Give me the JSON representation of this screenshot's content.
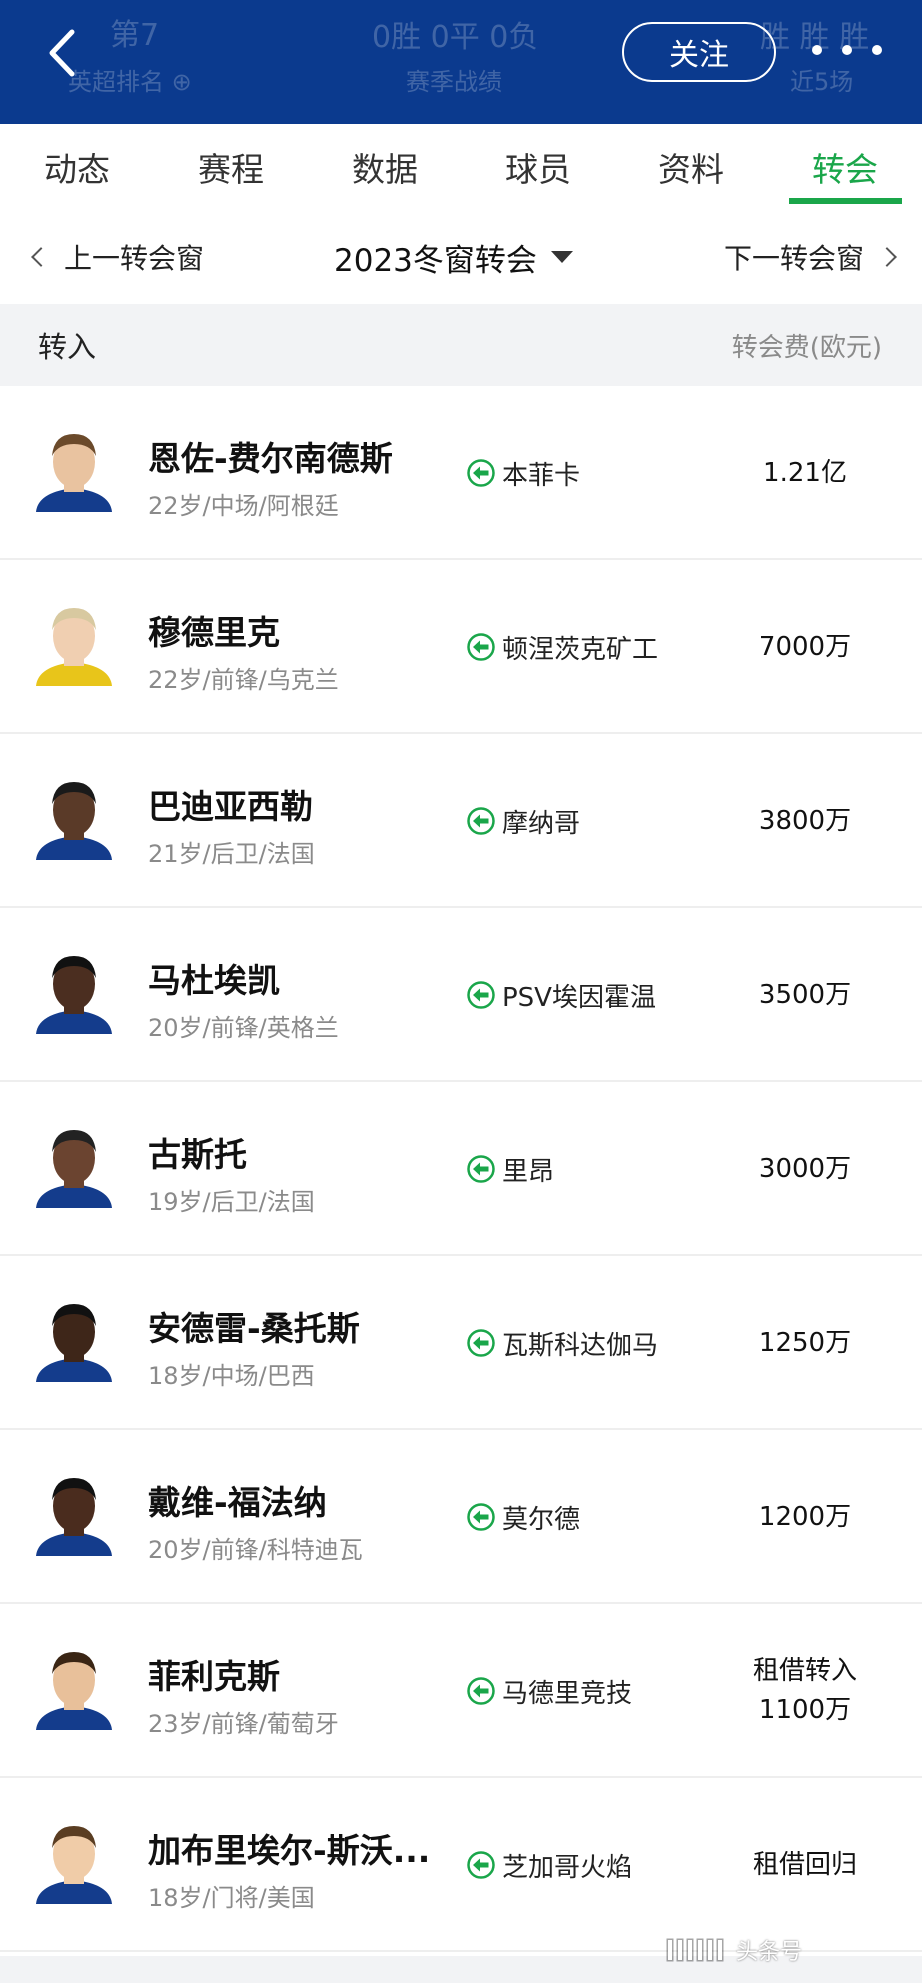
{
  "header": {
    "ghost_left_top": "第7",
    "ghost_left_bottom": "英超排名 ⊕",
    "ghost_mid_top": "0胜 0平 0负",
    "ghost_mid_bottom": "赛季战绩",
    "ghost_right_top": "胜 胜 胜",
    "ghost_right_bottom": "近5场",
    "follow_label": "关注",
    "colors": {
      "background": "#0b3a8e",
      "accent": "#1aa64a"
    }
  },
  "tabs": [
    "动态",
    "赛程",
    "数据",
    "球员",
    "资料",
    "转会"
  ],
  "active_tab": "转会",
  "window_nav": {
    "prev_label": "上一转会窗",
    "current_label": "2023冬窗转会",
    "next_label": "下一转会窗"
  },
  "section": {
    "title": "转入",
    "fee_header": "转会费(欧元)"
  },
  "players": [
    {
      "name": "恩佐-费尔南德斯",
      "info": "22岁/中场/阿根廷",
      "from_club": "本菲卡",
      "fee_line1": "1.21亿",
      "fee_line2": ""
    },
    {
      "name": "穆德里克",
      "info": "22岁/前锋/乌克兰",
      "from_club": "顿涅茨克矿工",
      "fee_line1": "7000万",
      "fee_line2": ""
    },
    {
      "name": "巴迪亚西勒",
      "info": "21岁/后卫/法国",
      "from_club": "摩纳哥",
      "fee_line1": "3800万",
      "fee_line2": ""
    },
    {
      "name": "马杜埃凯",
      "info": "20岁/前锋/英格兰",
      "from_club": "PSV埃因霍温",
      "fee_line1": "3500万",
      "fee_line2": ""
    },
    {
      "name": "古斯托",
      "info": "19岁/后卫/法国",
      "from_club": "里昂",
      "fee_line1": "3000万",
      "fee_line2": ""
    },
    {
      "name": "安德雷-桑托斯",
      "info": "18岁/中场/巴西",
      "from_club": "瓦斯科达伽马",
      "fee_line1": "1250万",
      "fee_line2": ""
    },
    {
      "name": "戴维-福法纳",
      "info": "20岁/前锋/科特迪瓦",
      "from_club": "莫尔德",
      "fee_line1": "1200万",
      "fee_line2": ""
    },
    {
      "name": "菲利克斯",
      "info": "23岁/前锋/葡萄牙",
      "from_club": "马德里竞技",
      "fee_line1": "租借转入",
      "fee_line2": "1100万"
    },
    {
      "name": "加布里埃尔-斯沃...",
      "info": "18岁/门将/美国",
      "from_club": "芝加哥火焰",
      "fee_line1": "租借回归",
      "fee_line2": ""
    }
  ],
  "icons": {
    "back": "chevron-left-icon",
    "more": "more-dots-icon",
    "transfer_in": "arrow-left-circle-icon"
  },
  "watermark": "头条号"
}
